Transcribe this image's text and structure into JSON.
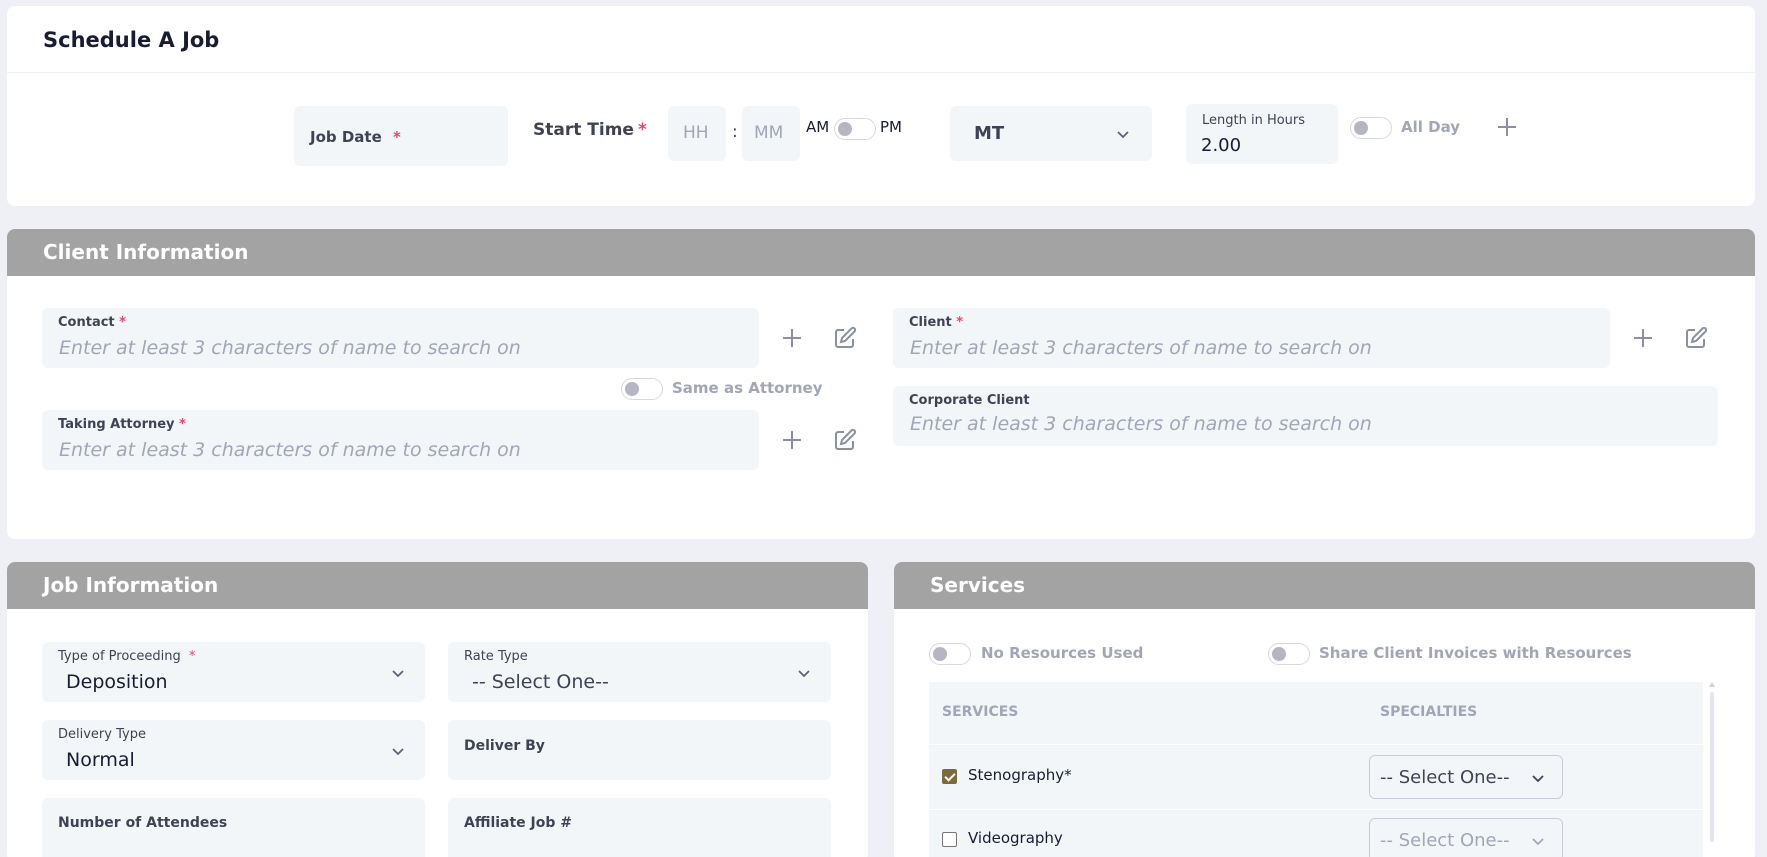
{
  "schedule": {
    "title": "Schedule A Job",
    "job_date_label": "Job Date",
    "start_time_label": "Start Time",
    "hh_placeholder": "HH",
    "time_separator": ":",
    "mm_placeholder": "MM",
    "am_label": "AM",
    "pm_label": "PM",
    "timezone_value": "MT",
    "length_label": "Length in Hours",
    "length_value": "2.00",
    "all_day_label": "All Day",
    "required_mark": "*"
  },
  "client_info": {
    "header": "Client Information",
    "contact_label": "Contact",
    "contact_placeholder": "Enter at least 3 characters of name to search on",
    "same_as_attorney_label": "Same as Attorney",
    "taking_attorney_label": "Taking Attorney",
    "taking_attorney_placeholder": "Enter at least 3 characters of name to search on",
    "client_label": "Client",
    "client_placeholder": "Enter at least 3 characters of name to search on",
    "corporate_client_label": "Corporate Client",
    "corporate_client_placeholder": "Enter at least 3 characters of name to search on"
  },
  "job_info": {
    "header": "Job Information",
    "type_of_proceeding_label": "Type of Proceeding",
    "type_of_proceeding_value": "Deposition",
    "rate_type_label": "Rate Type",
    "rate_type_value": "-- Select One--",
    "delivery_type_label": "Delivery Type",
    "delivery_type_value": "Normal",
    "deliver_by_label": "Deliver By",
    "number_of_attendees_label": "Number of Attendees",
    "affiliate_job_label": "Affiliate Job #"
  },
  "services": {
    "header": "Services",
    "no_resources_label": "No Resources Used",
    "share_invoices_label": "Share Client Invoices with Resources",
    "col_services": "SERVICES",
    "col_specialties": "SPECIALTIES",
    "rows": [
      {
        "name": "Stenography*",
        "checked": true,
        "specialty": "-- Select One--"
      },
      {
        "name": "Videography",
        "checked": false,
        "specialty": "-- Select One--"
      }
    ]
  }
}
